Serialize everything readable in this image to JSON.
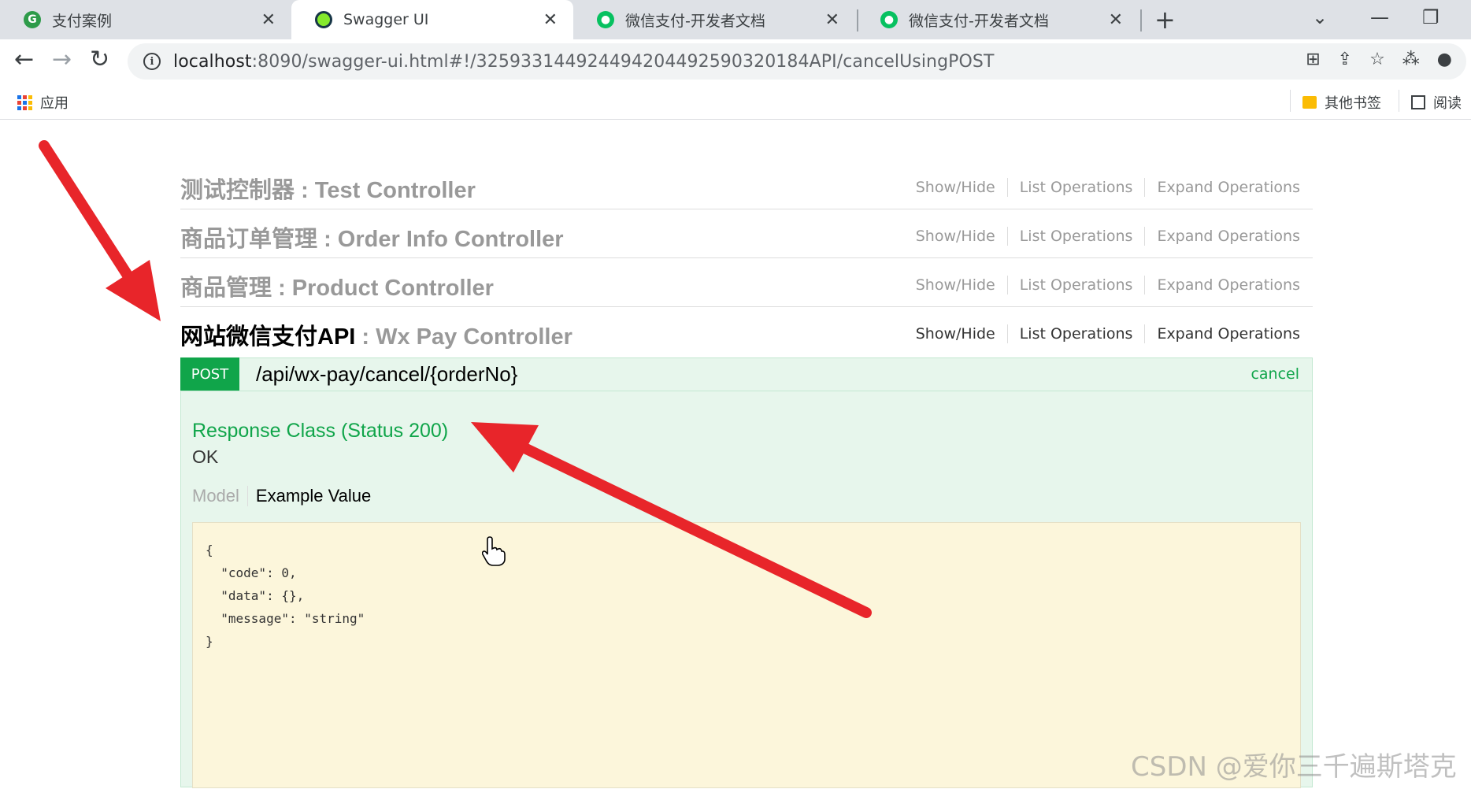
{
  "browser": {
    "tabs": [
      {
        "title": "支付案例",
        "icon": "g-icon",
        "color": "#2e9b4a"
      },
      {
        "title": "Swagger UI",
        "icon": "swagger-icon",
        "color": "#85ea2d"
      },
      {
        "title": "微信支付-开发者文档",
        "icon": "wechat-icon",
        "color": "#07c160"
      },
      {
        "title": "微信支付-开发者文档",
        "icon": "wechat-icon",
        "color": "#07c160"
      }
    ],
    "close_glyph": "✕",
    "new_tab_glyph": "+",
    "url_host": "localhost",
    "url_rest": ":8090/swagger-ui.html#!/325933144924494204492590320184API/cancelUsingPOST",
    "bookmarks": {
      "apps": "应用",
      "other": "其他书签",
      "reading": "阅读"
    }
  },
  "resources": [
    {
      "name_cn": "测试控制器",
      "name_en": "Test Controller",
      "sep": " : "
    },
    {
      "name_cn": "商品订单管理",
      "name_en": "Order Info Controller",
      "sep": " : "
    },
    {
      "name_cn": "商品管理",
      "name_en": "Product Controller",
      "sep": " : "
    },
    {
      "name_cn": "网站微信支付API",
      "name_en": "Wx Pay Controller",
      "sep": " : "
    }
  ],
  "resource_ops": {
    "show_hide": "Show/Hide",
    "list": "List Operations",
    "expand": "Expand Operations"
  },
  "operation": {
    "method": "POST",
    "path": "/api/wx-pay/cancel/{orderNo}",
    "summary": "cancel",
    "response_class": "Response Class (Status 200)",
    "response_text": "OK",
    "model_tab": "Model",
    "example_tab": "Example Value",
    "example_value": "{\n  \"code\": 0,\n  \"data\": {},\n  \"message\": \"string\"\n}"
  },
  "watermark": "CSDN @爱你三千遍斯塔克",
  "colors": {
    "post_green": "#10a54a",
    "operation_bg": "#e7f6ec",
    "example_bg": "#fcf6db",
    "arrow_red": "#e8252a"
  }
}
